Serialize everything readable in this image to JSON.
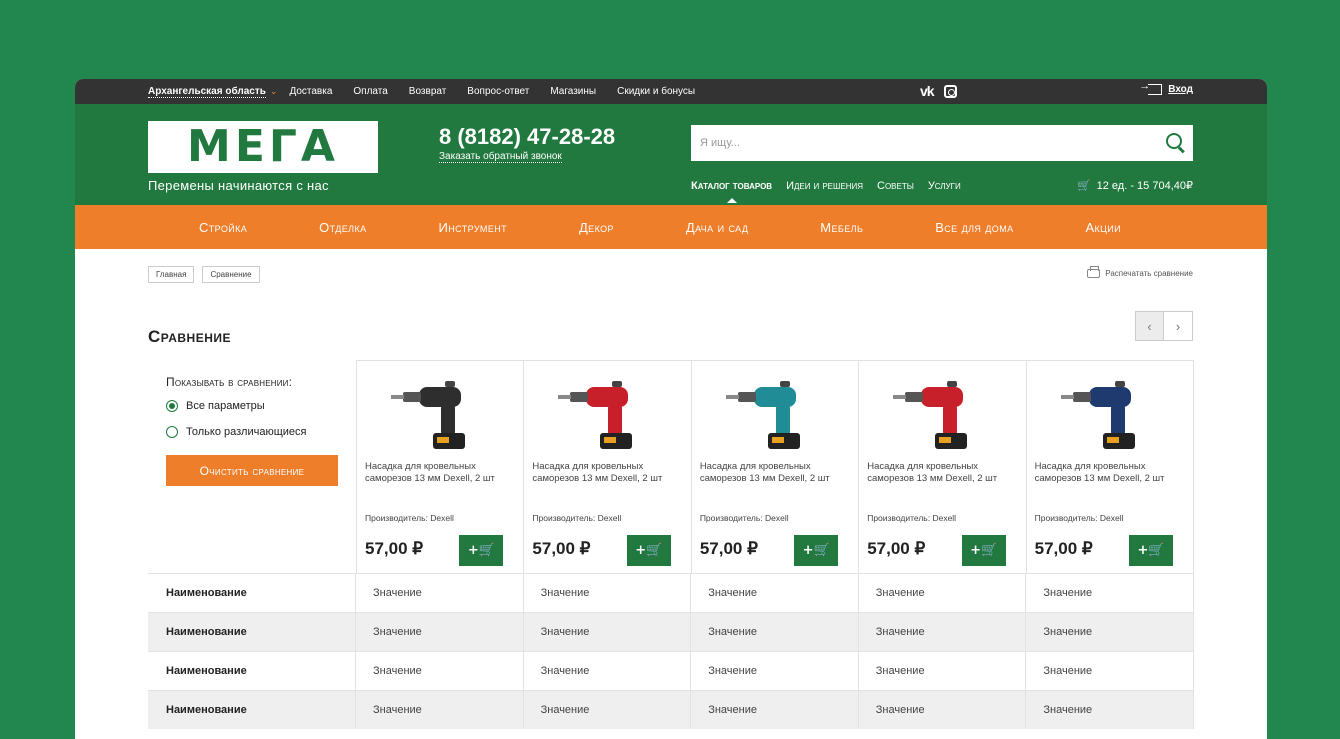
{
  "topbar": {
    "region": "Архангельская область",
    "links": [
      "Доставка",
      "Оплата",
      "Возврат",
      "Вопрос-ответ",
      "Магазины",
      "Скидки и бонусы"
    ],
    "social": [
      "vk-icon",
      "instagram-icon"
    ],
    "login": "Вход"
  },
  "header": {
    "logo": "МЕГА",
    "tagline": "Перемены начинаются с нас",
    "phone": "8 (8182) 47-28-28",
    "callback": "Заказать обратный звонок",
    "search_placeholder": "Я ищу...",
    "subnav": [
      "Каталог товаров",
      "Идеи и решения",
      "Советы",
      "Услуги"
    ],
    "cart": "12 ед. - 15 704,40₽"
  },
  "menu": [
    "Стройка",
    "Отделка",
    "Инструмент",
    "Декор",
    "Дача и сад",
    "Мебель",
    "Все для дома",
    "Акции"
  ],
  "breadcrumbs": [
    "Главная",
    "Сравнение"
  ],
  "print_label": "Распечатать сравнение",
  "page_title": "Сравнение",
  "filter": {
    "title": "Показывать в сравнении:",
    "options": [
      "Все параметры",
      "Только различающиеся"
    ],
    "selected": "Все параметры",
    "clear": "Очистить сравнение"
  },
  "products": [
    {
      "name": "Насадка для кровельных саморезов 13 мм Dexell, 2 шт",
      "maker": "Производитель: Dexell",
      "price": "57,00 ₽",
      "color": "#2e2e2e"
    },
    {
      "name": "Насадка для кровельных саморезов 13 мм Dexell, 2 шт",
      "maker": "Производитель: Dexell",
      "price": "57,00 ₽",
      "color": "#c8202a"
    },
    {
      "name": "Насадка для кровельных саморезов 13 мм Dexell, 2 шт",
      "maker": "Производитель: Dexell",
      "price": "57,00 ₽",
      "color": "#1f8c96"
    },
    {
      "name": "Насадка для кровельных саморезов 13 мм Dexell, 2 шт",
      "maker": "Производитель: Dexell",
      "price": "57,00 ₽",
      "color": "#c8202a"
    },
    {
      "name": "Насадка для кровельных саморезов 13 мм Dexell, 2 шт",
      "maker": "Производитель: Dexell",
      "price": "57,00 ₽",
      "color": "#1f3a6e"
    }
  ],
  "add_to_cart_label": "+🛒",
  "specs": [
    {
      "name": "Наименование",
      "values": [
        "Значение",
        "Значение",
        "Значение",
        "Значение",
        "Значение"
      ]
    },
    {
      "name": "Наименование",
      "values": [
        "Значение",
        "Значение",
        "Значение",
        "Значение",
        "Значение"
      ]
    },
    {
      "name": "Наименование",
      "values": [
        "Значение",
        "Значение",
        "Значение",
        "Значение",
        "Значение"
      ]
    },
    {
      "name": "Наименование",
      "values": [
        "Значение",
        "Значение",
        "Значение",
        "Значение",
        "Значение"
      ]
    }
  ],
  "colors": {
    "brand_green": "#22793f",
    "accent_orange": "#ef7e2b",
    "background": "#22874f"
  }
}
